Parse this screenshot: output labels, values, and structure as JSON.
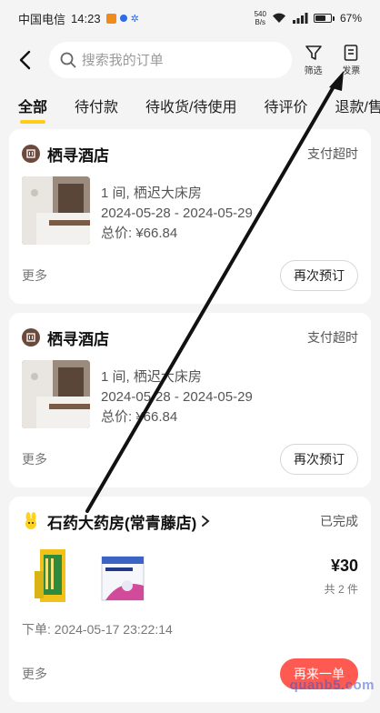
{
  "status_bar": {
    "carrier": "中国电信",
    "time": "14:23",
    "net_speed_value": "540",
    "net_speed_unit": "B/s",
    "battery": "67%"
  },
  "header": {
    "search_placeholder": "搜索我的订单",
    "filter_label": "筛选",
    "invoice_label": "发票"
  },
  "tabs": [
    "全部",
    "待付款",
    "待收货/待使用",
    "待评价",
    "退款/售后"
  ],
  "orders": [
    {
      "shop": "栖寻酒店",
      "status": "支付超时",
      "line1": "1 间, 栖迟大床房",
      "dates": "2024-05-28 - 2024-05-29",
      "total": "总价: ¥66.84",
      "more": "更多",
      "action": "再次预订"
    },
    {
      "shop": "栖寻酒店",
      "status": "支付超时",
      "line1": "1 间, 栖迟大床房",
      "dates": "2024-05-28 - 2024-05-29",
      "total": "总价: ¥66.84",
      "more": "更多",
      "action": "再次预订"
    }
  ],
  "pharmacy": {
    "shop": "石药大药房(常青藤店)",
    "status": "已完成",
    "price": "¥30",
    "qty": "共 2 件",
    "order_time": "下单: 2024-05-17 23:22:14",
    "more": "更多",
    "action": "再来一单"
  },
  "watermark": "quanb5.com",
  "colors": {
    "accent": "#ffcc1a",
    "cta": "#ff5a52",
    "hotel_icon": "#6b4a3d"
  }
}
